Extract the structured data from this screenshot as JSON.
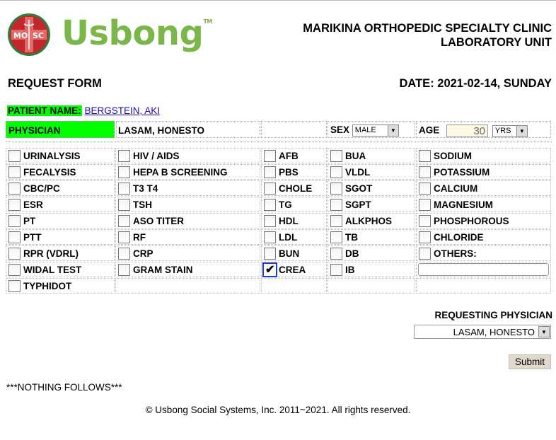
{
  "header": {
    "brand": "Usbong",
    "logo_text_left": "MO",
    "logo_text_right": "SC",
    "clinic_line1": "MARIKINA ORTHOPEDIC SPECIALTY CLINIC",
    "clinic_line2": "LABORATORY UNIT"
  },
  "form": {
    "title": "REQUEST FORM",
    "date": "DATE: 2021-02-14, SUNDAY",
    "patient_label": "PATIENT NAME:",
    "patient_name": "BERGSTEIN, AKI",
    "physician_label": "PHYSICIAN",
    "physician_name": "LASAM, HONESTO",
    "sex_label": "SEX",
    "sex_value": "MALE",
    "age_label": "AGE",
    "age_value": "30",
    "age_unit": "YRS"
  },
  "tests": {
    "col1": [
      "URINALYSIS",
      "FECALYSIS",
      "CBC/PC",
      "ESR",
      "PT",
      "PTT",
      "RPR (VDRL)",
      "WIDAL TEST",
      "TYPHIDOT"
    ],
    "col2": [
      "HIV / AIDS",
      "HEPA B SCREENING",
      "T3 T4",
      "TSH",
      "ASO TITER",
      "RF",
      "CRP",
      "GRAM STAIN"
    ],
    "col3": [
      "AFB",
      "PBS",
      "CHOLE",
      "TG",
      "HDL",
      "LDL",
      "BUN",
      "CREA"
    ],
    "col4": [
      "BUA",
      "VLDL",
      "SGOT",
      "SGPT",
      "ALKPHOS",
      "TB",
      "DB",
      "IB"
    ],
    "col5": [
      "SODIUM",
      "POTASSIUM",
      "CALCIUM",
      "MAGNESIUM",
      "PHOSPHOROUS",
      "CHLORIDE",
      "OTHERS:"
    ],
    "checked": [
      "CREA"
    ]
  },
  "requesting": {
    "label": "REQUESTING PHYSICIAN",
    "value": "LASAM, HONESTO"
  },
  "submit_label": "Submit",
  "nothing_follows": "***NOTHING FOLLOWS***",
  "footer": "© Usbong Social Systems, Inc. 2011~2021. All rights reserved.",
  "colors": {
    "highlight": "#00ff00",
    "brand_green": "#7ab648",
    "logo_red": "#c0282d",
    "checkbox_focus": "#1c3bd8"
  }
}
